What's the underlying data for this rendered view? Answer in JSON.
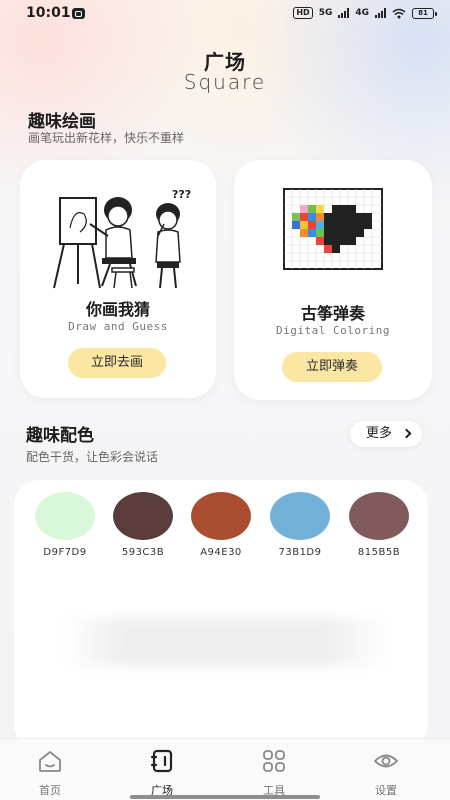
{
  "status_bar": {
    "time": "10:01",
    "hd_label": "HD",
    "net_5g": "5G",
    "net_4g": "4G",
    "battery": "81"
  },
  "header": {
    "title": "广场",
    "subtitle": "Square"
  },
  "drawing_section": {
    "title": "趣味绘画",
    "description": "画笔玩出新花样，快乐不重样",
    "cards": [
      {
        "title": "你画我猜",
        "subtitle": "Draw and Guess",
        "button": "立即去画",
        "icon": "drawing-kids-illustration-icon",
        "speech": "???"
      },
      {
        "title": "古筝弹奏",
        "subtitle": "Digital Coloring",
        "button": "立即弹奏",
        "icon": "pixel-heart-grid-icon"
      }
    ]
  },
  "color_section": {
    "title": "趣味配色",
    "description": "配色干货，让色彩会说话",
    "more_label": "更多",
    "swatches": [
      {
        "code": "D9F7D9",
        "color": "#D9F7D9"
      },
      {
        "code": "593C3B",
        "color": "#593C3B"
      },
      {
        "code": "A94E30",
        "color": "#A94E30"
      },
      {
        "code": "73B1D9",
        "color": "#73B1D9"
      },
      {
        "code": "815B5B",
        "color": "#815B5B"
      }
    ]
  },
  "bottom_nav": {
    "items": [
      {
        "label": "首页",
        "icon": "home-icon"
      },
      {
        "label": "广场",
        "icon": "square-icon",
        "active": true
      },
      {
        "label": "工具",
        "icon": "tools-grid-icon"
      },
      {
        "label": "设置",
        "icon": "eye-settings-icon"
      }
    ]
  }
}
